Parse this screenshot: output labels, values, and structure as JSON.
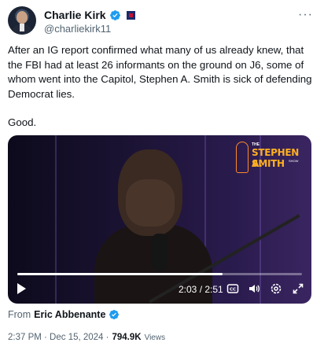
{
  "author": {
    "name": "Charlie Kirk",
    "handle": "@charliekirk11"
  },
  "more_menu": "···",
  "tweet": {
    "text": "After an IG report confirmed what many of us already knew, that the FBI had at least 26 informants on the ground on J6, some of whom went into the Capitol, Stephen A. Smith is sick of defending Democrat lies.",
    "text2": "Good."
  },
  "video": {
    "logo_the": "THE",
    "logo_line1": "STEPHEN A.",
    "logo_line2": "SMITH",
    "logo_show": "SHOW",
    "current_time": "2:03",
    "duration": "2:51",
    "time_display": "2:03 / 2:51",
    "progress_fraction": 0.72
  },
  "attribution": {
    "label": "From",
    "name": "Eric Abbenante"
  },
  "meta": {
    "timestamp": "2:37 PM · Dec 15, 2024 ·",
    "views_count": "794.9K",
    "views_label": "Views"
  },
  "colors": {
    "verified": "#1d9bf0",
    "text_secondary": "#536471",
    "text_primary": "#0f1419"
  },
  "icons": [
    "verified-badge-icon",
    "flag-icon",
    "more-icon",
    "play-icon",
    "captions-icon",
    "volume-icon",
    "settings-icon",
    "fullscreen-icon"
  ]
}
